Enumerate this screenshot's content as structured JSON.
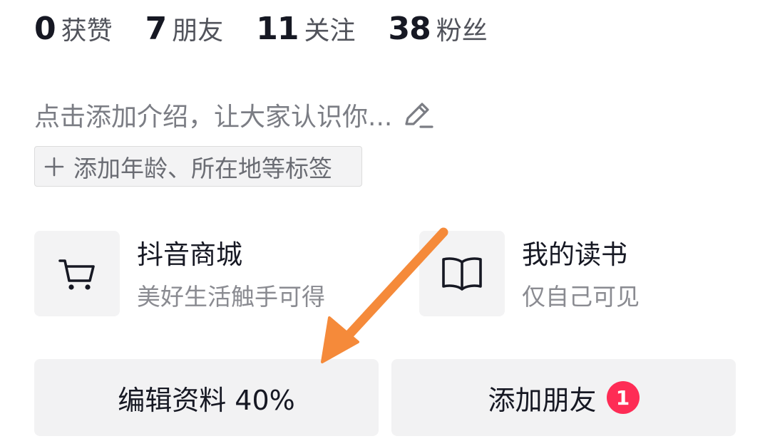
{
  "stats": [
    {
      "value": "0",
      "label": "获赞"
    },
    {
      "value": "7",
      "label": "朋友"
    },
    {
      "value": "11",
      "label": "关注"
    },
    {
      "value": "38",
      "label": "粉丝"
    }
  ],
  "bio": {
    "placeholder_text": "点击添加介绍，让大家认识你...",
    "edit_icon": "pencil-icon"
  },
  "tag_chip": {
    "icon": "plus-icon",
    "label": "添加年龄、所在地等标签"
  },
  "services": [
    {
      "icon": "cart-icon",
      "title": "抖音商城",
      "subtitle": "美好生活触手可得"
    },
    {
      "icon": "book-icon",
      "title": "我的读书",
      "subtitle": "仅自己可见"
    }
  ],
  "buttons": {
    "edit_profile": "编辑资料 40%",
    "add_friends": "添加朋友",
    "add_friends_badge": "1"
  },
  "colors": {
    "annotation_arrow": "#f58a3a",
    "badge": "#fe2c55",
    "card_bg": "#f2f2f3"
  }
}
